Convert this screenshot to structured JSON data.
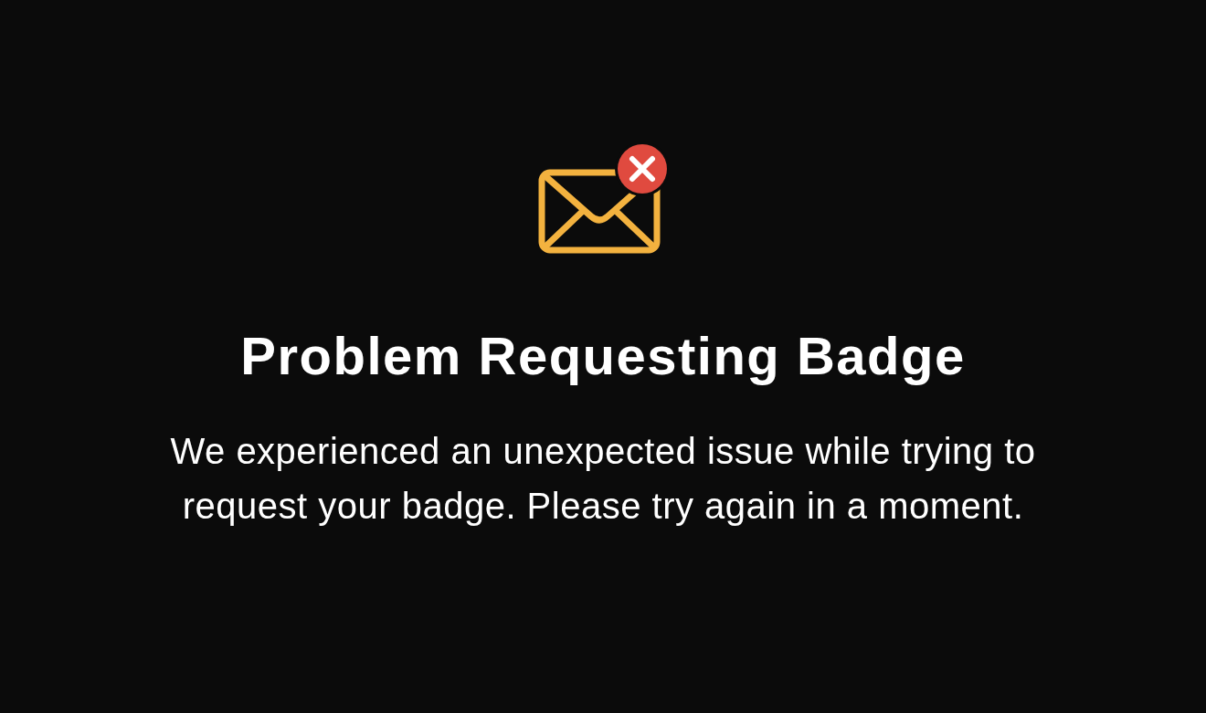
{
  "error": {
    "title": "Problem Requesting Badge",
    "message": "We experienced an unexpected issue while trying to request your badge. Please try again in a moment."
  }
}
